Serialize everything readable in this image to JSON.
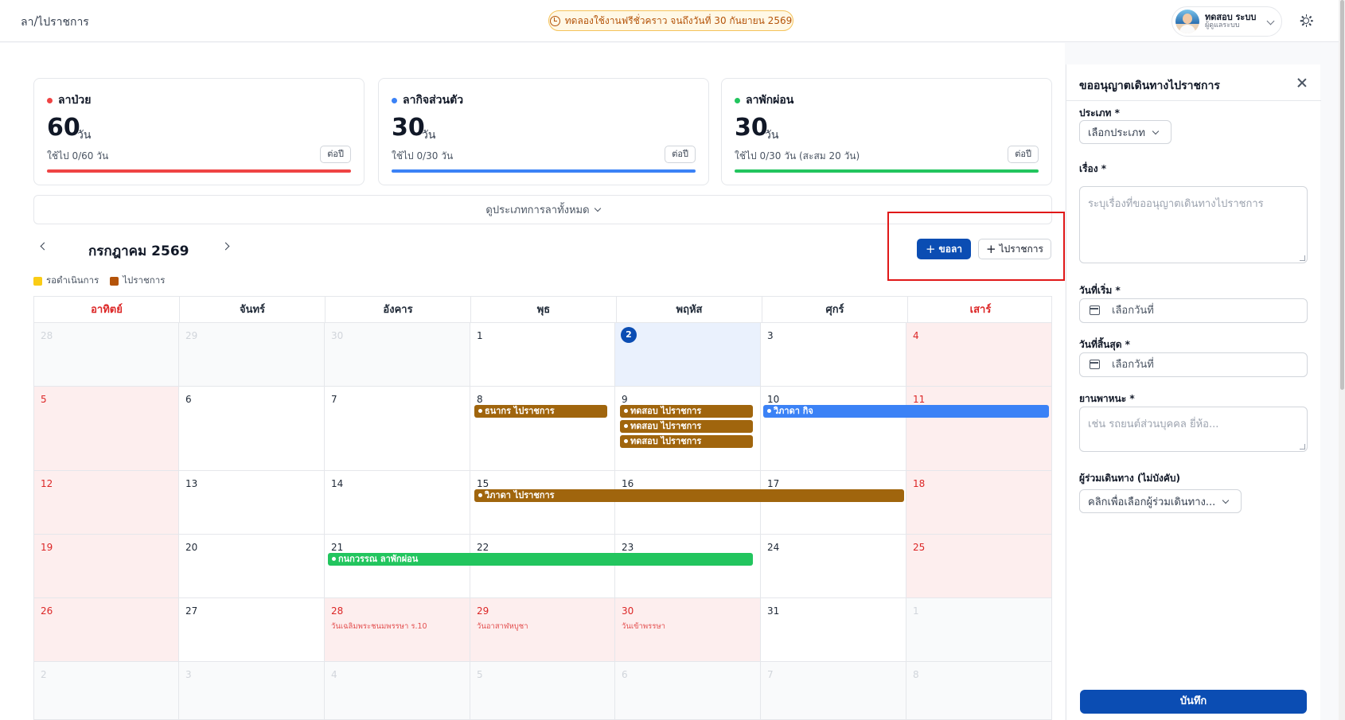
{
  "header": {
    "breadcrumb": "ลา/ไปราชการ",
    "trial_text": "ทดลองใช้งานฟรีชั่วคราว จนถึงวันที่ 30 กันยายน 2569",
    "user_name": "ทดสอบ ระบบ",
    "user_role": "ผู้ดูแลระบบ",
    "icons": [
      "clock-icon",
      "chevron-down-icon",
      "sun-icon"
    ]
  },
  "cards": [
    {
      "title": "ลาป่วย",
      "days": "60",
      "unit": "วัน",
      "used": "ใช้ไป 0/60 วัน",
      "period": "ต่อปี",
      "color": "#ef4444"
    },
    {
      "title": "ลากิจส่วนตัว",
      "days": "30",
      "unit": "วัน",
      "used": "ใช้ไป 0/30 วัน",
      "period": "ต่อปี",
      "color": "#3b82f6"
    },
    {
      "title": "ลาพักผ่อน",
      "days": "30",
      "unit": "วัน",
      "used": "ใช้ไป 0/30 วัน (สะสม 20 วัน)",
      "period": "ต่อปี",
      "color": "#22c55e"
    }
  ],
  "view_all": "ดูประเภทการลาทั้งหมด",
  "calendar": {
    "month_label": "กรกฎาคม 2569",
    "btn_leave": "ขอลา",
    "btn_trip": "ไปราชการ",
    "legend": [
      {
        "label": "รอดำเนินการ",
        "color": "#facc15"
      },
      {
        "label": "ไปราชการ",
        "color": "#b45309"
      }
    ],
    "weekdays": [
      "อาทิตย์",
      "จันทร์",
      "อังคาร",
      "พุธ",
      "พฤหัส",
      "ศุกร์",
      "เสาร์"
    ],
    "weeks": [
      [
        "28",
        "29",
        "30",
        "1",
        "2",
        "3",
        "4"
      ],
      [
        "5",
        "6",
        "7",
        "8",
        "9",
        "10",
        "11"
      ],
      [
        "12",
        "13",
        "14",
        "15",
        "16",
        "17",
        "18"
      ],
      [
        "19",
        "20",
        "21",
        "22",
        "23",
        "24",
        "25"
      ],
      [
        "26",
        "27",
        "28",
        "29",
        "30",
        "31",
        "1"
      ],
      [
        "2",
        "3",
        "4",
        "5",
        "6",
        "7",
        "8"
      ]
    ],
    "holidays": [
      {
        "label": "วันเฉลิมพระชนมพรรษา ร.10"
      },
      {
        "label": "วันอาสาฬหบูชา"
      },
      {
        "label": "วันเข้าพรรษา"
      }
    ],
    "events": [
      {
        "label": "ธนากร ไปราชการ",
        "type": "trip"
      },
      {
        "label": "ทดสอบ ไปราชการ",
        "type": "trip"
      },
      {
        "label": "ทดสอบ ไปราชการ",
        "type": "trip"
      },
      {
        "label": "ทดสอบ ไปราชการ",
        "type": "trip"
      },
      {
        "label": "วิภาดา กิจ",
        "type": "personal"
      },
      {
        "label": "วิภาดา ไปราชการ",
        "type": "trip"
      },
      {
        "label": "กนกวรรณ ลาพักผ่อน",
        "type": "vacation"
      }
    ],
    "event_colors": {
      "trip": "#a0650d",
      "personal": "#3b82f6",
      "vacation": "#22c55e"
    }
  },
  "form": {
    "title": "ขออนุญาตเดินทางไปราชการ",
    "type_label": "ประเภท *",
    "type_placeholder": "เลือกประเภท",
    "subject_label": "เรื่อง *",
    "subject_placeholder": "ระบุเรื่องที่ขออนุญาตเดินทางไปราชการ",
    "start_label": "วันที่เริ่ม *",
    "start_placeholder": "เลือกวันที่",
    "end_label": "วันที่สิ้นสุด *",
    "end_placeholder": "เลือกวันที่",
    "vehicle_label": "ยานพาหนะ *",
    "vehicle_placeholder": "เช่น รถยนต์ส่วนบุคคล ยี่ห้อ...",
    "companions_label": "ผู้ร่วมเดินทาง (ไม่บังคับ)",
    "companions_placeholder": "คลิกเพื่อเลือกผู้ร่วมเดินทาง...",
    "save_label": "บันทึก"
  },
  "accent_color": "#0b4db3"
}
